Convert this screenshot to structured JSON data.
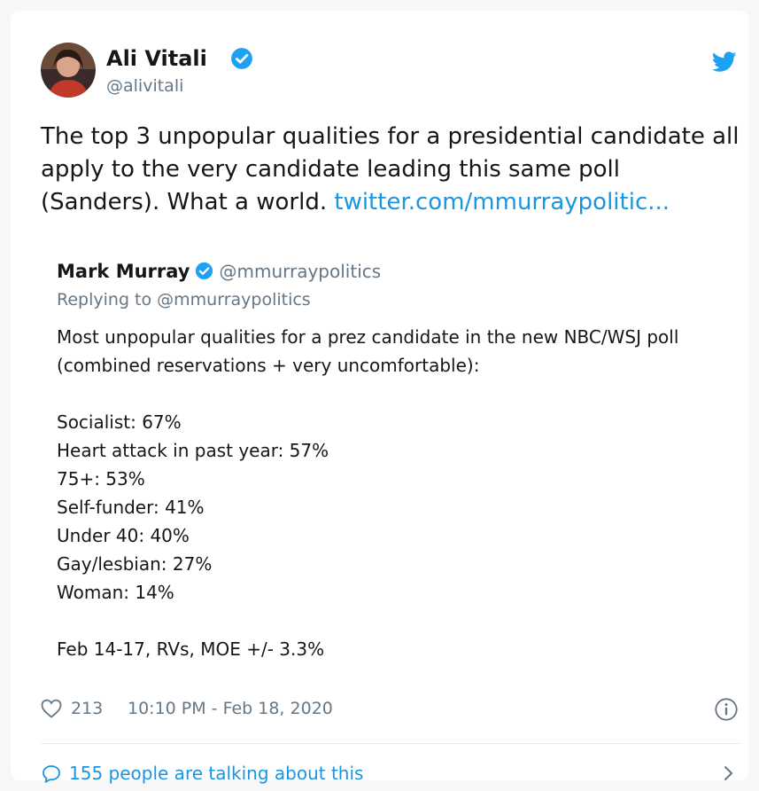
{
  "tweet": {
    "author": {
      "display_name": "Ali Vitali",
      "handle": "@alivitali",
      "verified": true
    },
    "text": "The top 3 unpopular qualities for a presidential candidate all apply to the very candidate leading this same poll (Sanders). What a world. ",
    "link_text": "twitter.com/mmurraypolitic...",
    "quoted": {
      "display_name": "Mark Murray",
      "handle": "@mmurraypolitics",
      "replying_to": "Replying to @mmurraypolitics",
      "intro": "Most unpopular qualities for a prez candidate in the new NBC/WSJ poll (combined reservations + very uncomfortable):",
      "list": [
        "Socialist: 67%",
        "Heart attack in past year: 57%",
        "75+: 53%",
        "Self-funder: 41%",
        "Under 40: 40%",
        "Gay/lesbian: 27%",
        "Woman: 14%"
      ],
      "footer": "Feb 14-17, RVs, MOE +/- 3.3%"
    },
    "likes": "213",
    "timestamp": "10:10 PM - Feb 18, 2020",
    "talking": "155 people are talking about this"
  },
  "icons": {
    "verified": "verified-badge-icon",
    "bird": "twitter-bird-icon",
    "heart": "heart-icon",
    "info": "info-icon",
    "bubble": "speech-bubble-icon",
    "chevron": "chevron-right-icon"
  },
  "colors": {
    "brand": "#1da1f2",
    "link": "#1b95e0",
    "secondary_text": "#657786",
    "text": "#14171a"
  }
}
